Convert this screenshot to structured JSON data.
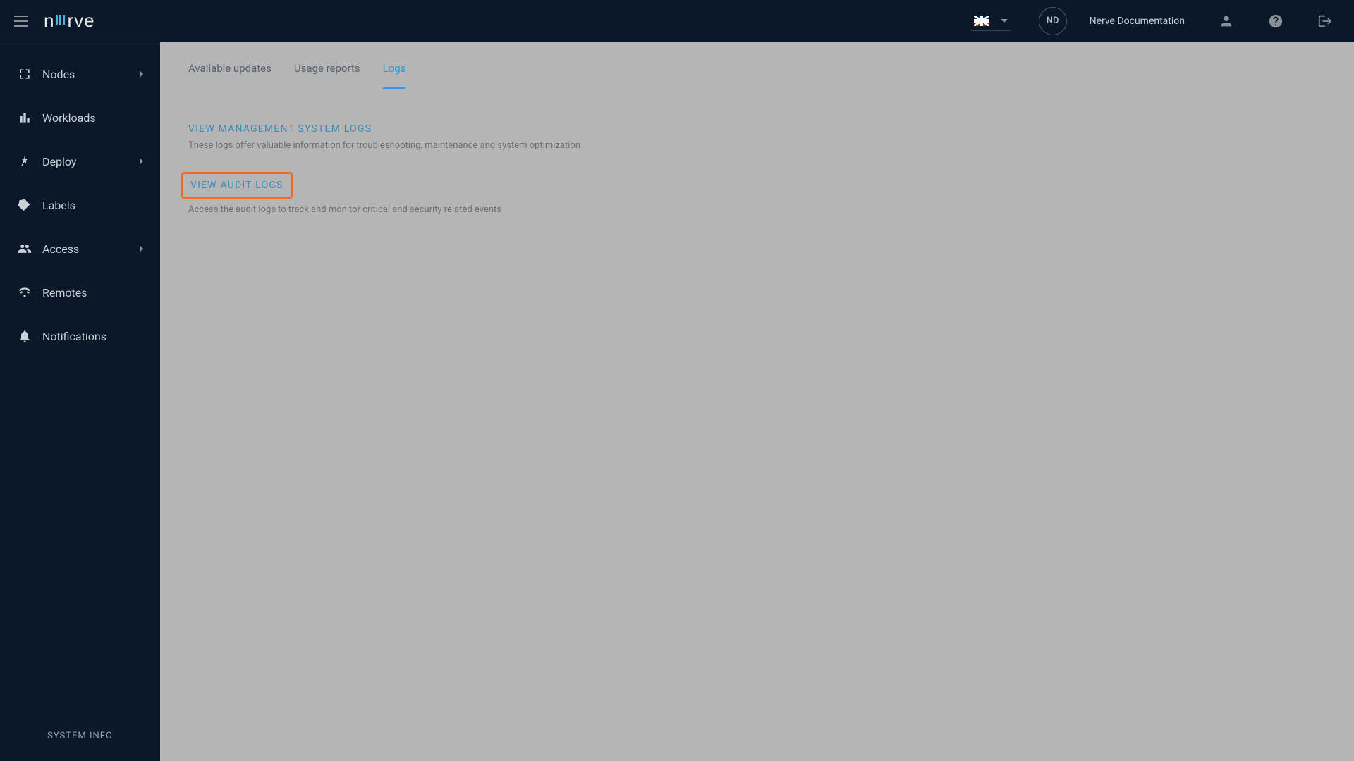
{
  "header": {
    "avatar_initials": "ND",
    "doc_link": "Nerve Documentation"
  },
  "sidebar": {
    "items": [
      {
        "label": "Nodes"
      },
      {
        "label": "Workloads"
      },
      {
        "label": "Deploy"
      },
      {
        "label": "Labels"
      },
      {
        "label": "Access"
      },
      {
        "label": "Remotes"
      },
      {
        "label": "Notifications"
      }
    ],
    "footer": "SYSTEM INFO"
  },
  "tabs": [
    {
      "label": "Available updates"
    },
    {
      "label": "Usage reports"
    },
    {
      "label": "Logs"
    }
  ],
  "sections": [
    {
      "title": "VIEW MANAGEMENT SYSTEM LOGS",
      "desc": "These logs offer valuable information for troubleshooting, maintenance and system optimization"
    },
    {
      "title": "VIEW AUDIT LOGS",
      "desc": "Access the audit logs to track and monitor critical and security related events"
    }
  ]
}
